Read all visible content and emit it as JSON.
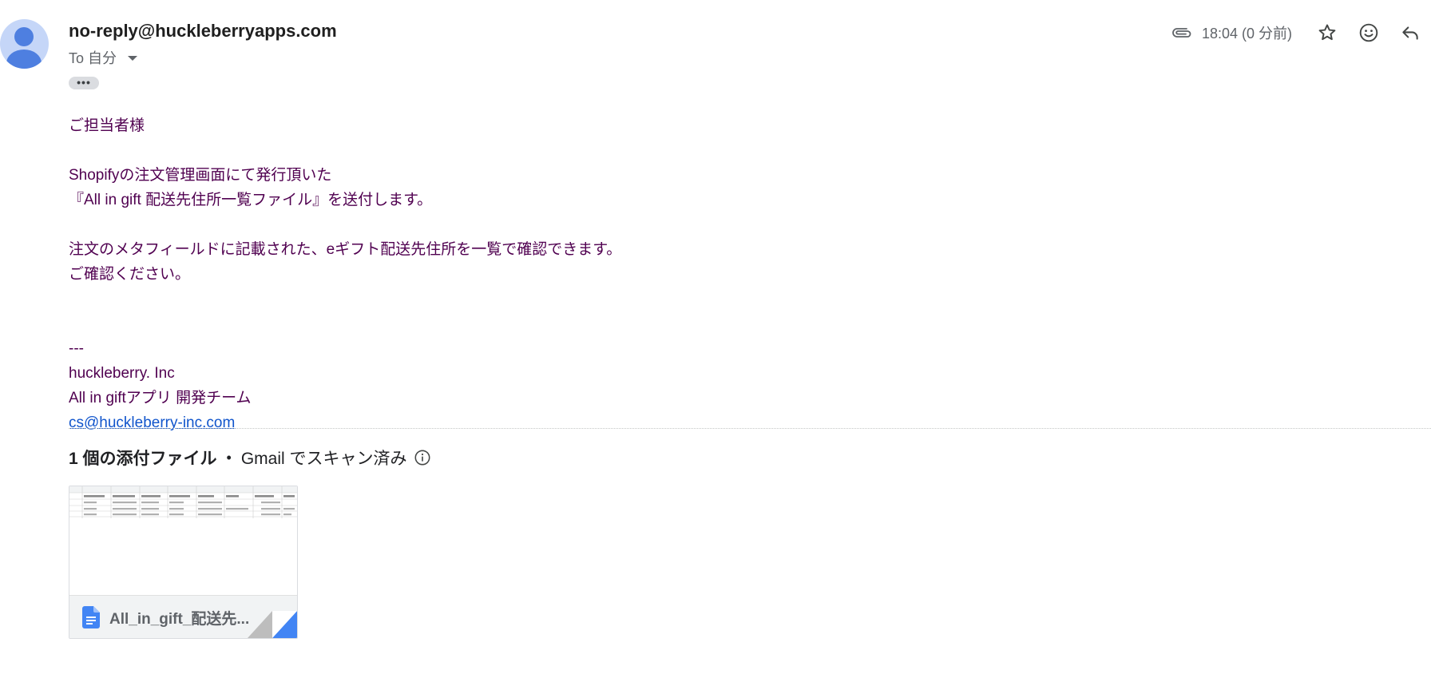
{
  "email": {
    "sender": "no-reply@huckleberryapps.com",
    "to_label": "To 自分",
    "ellipsis": "•••",
    "time": "18:04 (0 分前)",
    "icons": [
      "attachment-icon",
      "star-icon",
      "emoji-icon",
      "reply-icon"
    ]
  },
  "body": {
    "greeting": "ご担当者様",
    "para1_line1": "Shopifyの注文管理画面にて発行頂いた",
    "para1_line2": "『All in gift 配送先住所一覧ファイル』を送付します。",
    "para2_line1": "注文のメタフィールドに記載された、eギフト配送先住所を一覧で確認できます。",
    "para2_line2": "ご確認ください。",
    "sig_sep": "---",
    "sig_company": "huckleberry. Inc",
    "sig_team": "All in giftアプリ 開発チーム",
    "sig_email": "cs@huckleberry-inc.com"
  },
  "attachments": {
    "count_label": "1 個の添付ファイル",
    "separator": "•",
    "scan_label": "Gmail でスキャン済み",
    "file_name": "All_in_gift_配送先..."
  },
  "colors": {
    "body_text": "#500050",
    "link": "#1155cc",
    "avatar_bg": "#c5d6f8",
    "avatar_fg": "#4e7fe0",
    "doc_icon": "#4285f4"
  }
}
